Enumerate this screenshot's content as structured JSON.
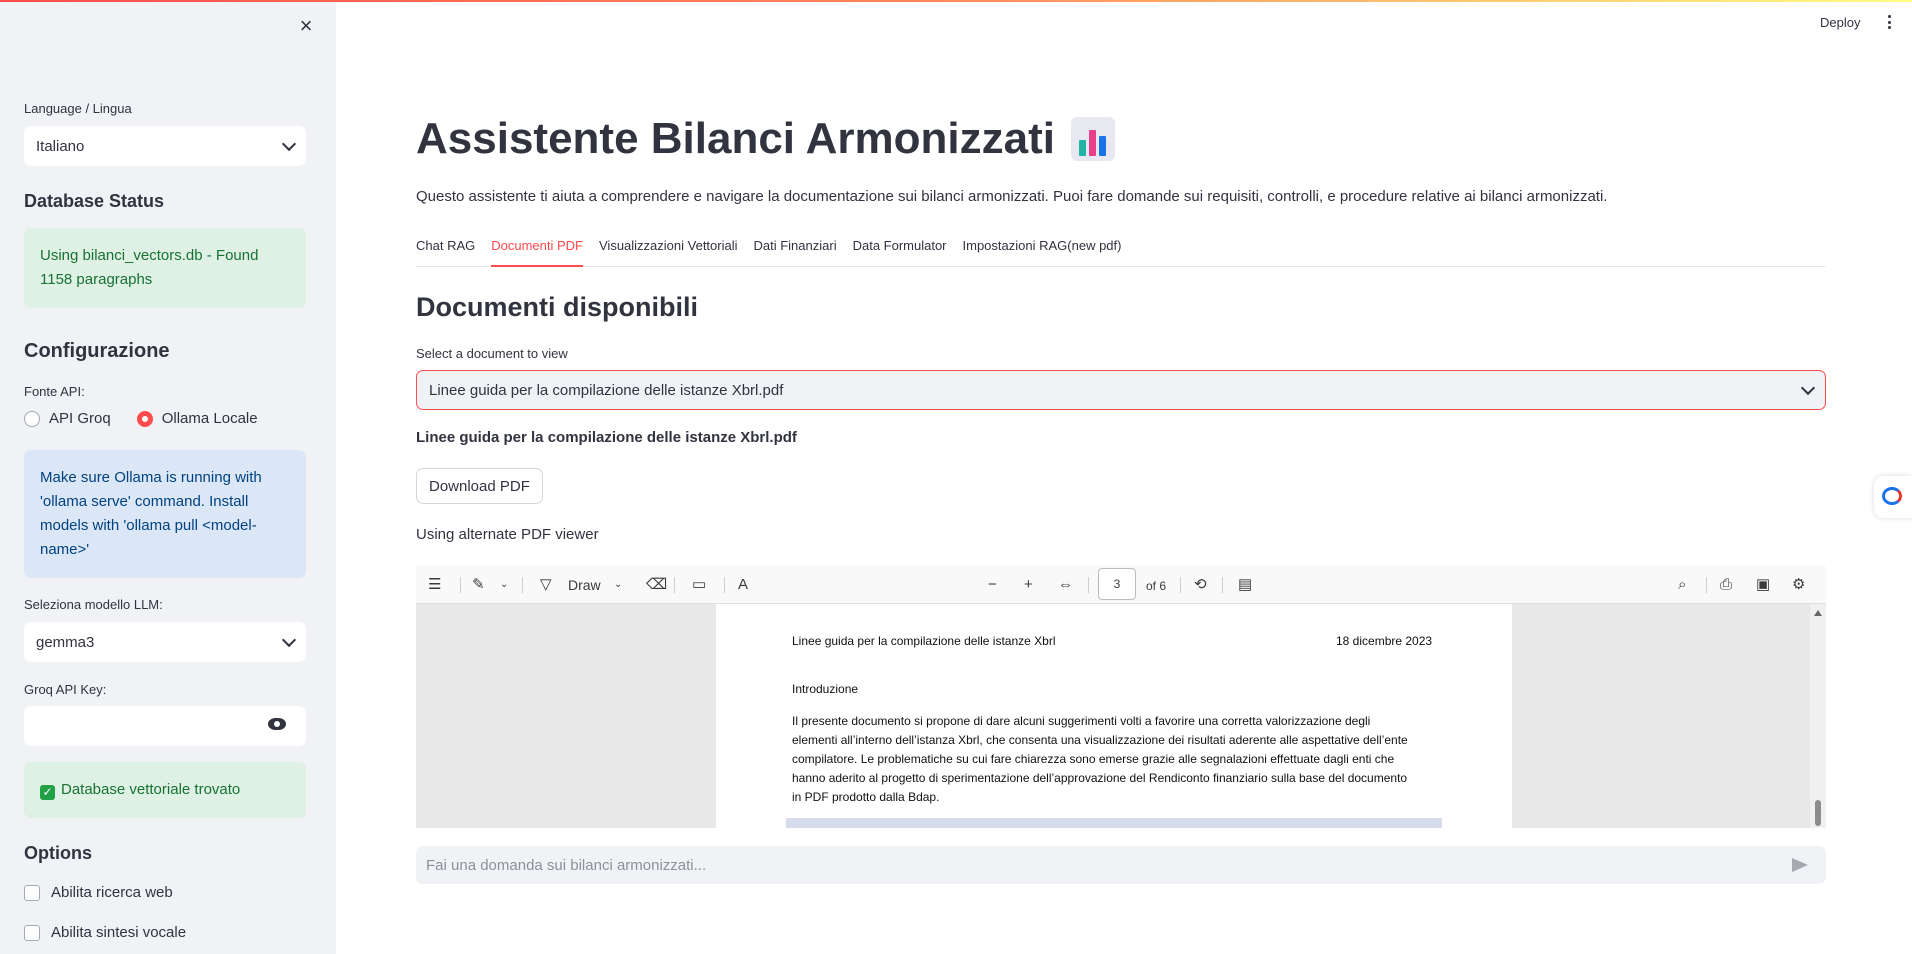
{
  "sidebar": {
    "language_label": "Language / Lingua",
    "language_value": "Italiano",
    "db_status_heading": "Database Status",
    "db_status_message": "Using bilanci_vectors.db - Found 1158 paragraphs",
    "config_heading": "Configurazione",
    "api_source_label": "Fonte API:",
    "api_options": [
      "API Groq",
      "Ollama Locale"
    ],
    "api_selected": "Ollama Locale",
    "ollama_info": "Make sure Ollama is running with 'ollama serve' command. Install models with 'ollama pull <model-name>'",
    "model_label": "Seleziona modello LLM:",
    "model_value": "gemma3",
    "groq_key_label": "Groq API Key:",
    "groq_key_value": "",
    "vector_db_found": "Database vettoriale trovato",
    "options_heading": "Options",
    "option_web_search": "Abilita ricerca web",
    "option_tts": "Abilita sintesi vocale"
  },
  "header": {
    "deploy_label": "Deploy"
  },
  "main": {
    "title": "Assistente Bilanci Armonizzati",
    "subtitle": "Questo assistente ti aiuta a comprendere e navigare la documentazione sui bilanci armonizzati. Puoi fare domande sui requisiti, controlli, e procedure relative ai bilanci armonizzati.",
    "tabs": [
      {
        "label": "Chat RAG"
      },
      {
        "label": "Documenti PDF"
      },
      {
        "label": "Visualizzazioni Vettoriali"
      },
      {
        "label": "Dati Finanziari"
      },
      {
        "label": "Data Formulator"
      },
      {
        "label": "Impostazioni RAG(new pdf)"
      }
    ],
    "active_tab": "Documenti PDF",
    "section_heading": "Documenti disponibili",
    "select_label": "Select a document to view",
    "selected_document": "Linee guida per la compilazione delle istanze Xbrl.pdf",
    "document_name": "Linee guida per la compilazione delle istanze Xbrl.pdf",
    "download_label": "Download PDF",
    "alt_viewer_text": "Using alternate PDF viewer",
    "chat_placeholder": "Fai una domanda sui bilanci armonizzati..."
  },
  "pdf_viewer": {
    "draw_label": "Draw",
    "current_page": "3",
    "page_total": "of 6",
    "page": {
      "header_left": "Linee guida per la compilazione delle istanze Xbrl",
      "header_right": "18 dicembre 2023",
      "section": "Introduzione",
      "lines": [
        "Il presente documento si propone di dare alcuni suggerimenti volti a favorire una corretta valorizzazione degli",
        "elementi all’interno dell’istanza Xbrl, che consenta una visualizzazione dei risultati aderente alle aspettative dell’ente",
        "compilatore. Le problematiche su cui fare chiarezza sono emerse grazie alle segnalazioni effettuate dagli enti che",
        "hanno aderito al progetto di sperimentazione dell’approvazione del Rendiconto finanziario sulla base del documento",
        "in PDF prodotto dalla Bdap."
      ]
    }
  },
  "colors": {
    "accent": "#ff4b4b",
    "sidebar_bg": "#f0f2f6",
    "success_bg": "#dff0e4",
    "info_bg": "#dbe7f6"
  }
}
